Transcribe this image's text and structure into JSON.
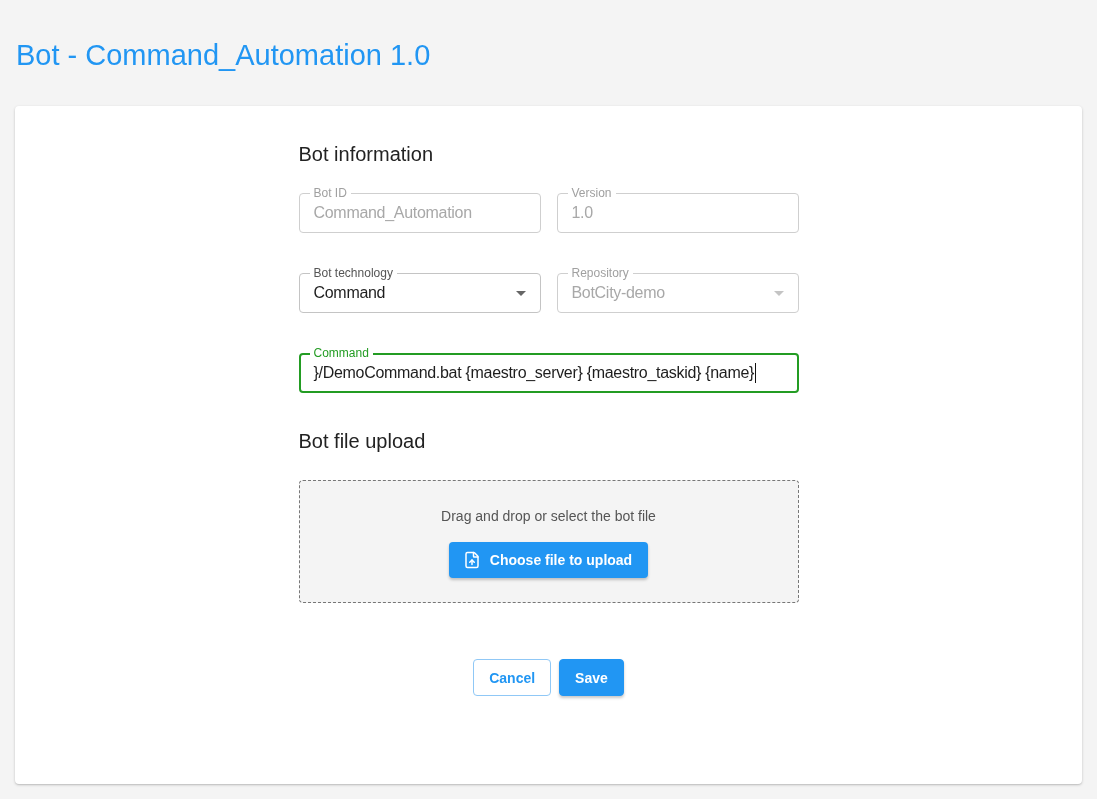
{
  "page_title": "Bot - Command_Automation 1.0",
  "bot_information": {
    "heading": "Bot information",
    "rows": [
      {
        "fields": [
          {
            "kind": "text",
            "label": "Bot ID",
            "value": "Command_Automation",
            "disabled": true,
            "focused": false
          },
          {
            "kind": "text",
            "label": "Version",
            "value": "1.0",
            "disabled": true,
            "focused": false
          }
        ]
      },
      {
        "fields": [
          {
            "kind": "select",
            "label": "Bot technology",
            "value": "Command",
            "disabled": false,
            "focused": false
          },
          {
            "kind": "select",
            "label": "Repository",
            "value": "BotCity-demo",
            "disabled": true,
            "focused": false
          }
        ]
      },
      {
        "fields": [
          {
            "kind": "text",
            "label": "Command",
            "value": "}/DemoCommand.bat {maestro_server} {maestro_taskid} {name}",
            "disabled": false,
            "focused": true
          }
        ]
      }
    ]
  },
  "upload": {
    "heading": "Bot file upload",
    "hint": "Drag and drop or select the bot file",
    "button": "Choose file to upload"
  },
  "buttons": [
    {
      "kind": "outlined",
      "label": "Cancel"
    },
    {
      "kind": "contained",
      "label": "Save"
    }
  ]
}
